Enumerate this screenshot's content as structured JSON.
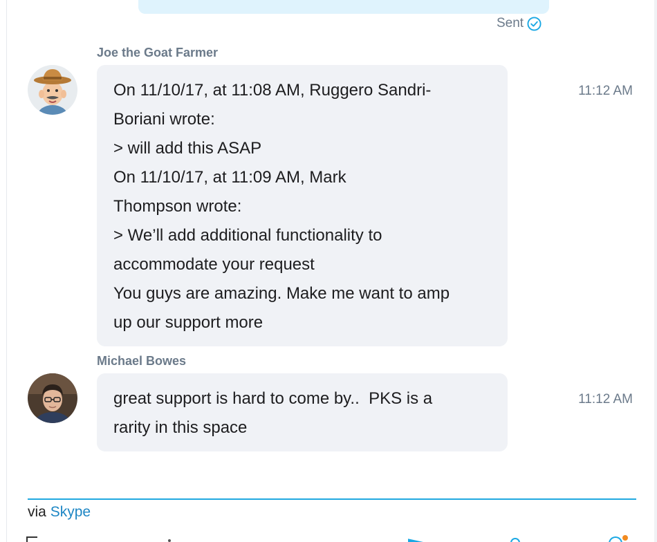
{
  "previous_message": {
    "status": "Sent",
    "status_icon": "check-circle-icon",
    "accent": "#1aa8e4"
  },
  "messages": [
    {
      "sender": "Joe the Goat Farmer",
      "avatar_icon": "farmer-avatar",
      "lines": [
        "On 11/10/17, at 11:08 AM, Ruggero Sandri-",
        "Boriani wrote:",
        "> will add this ASAP",
        "On 11/10/17, at 11:09 AM, Mark",
        "Thompson wrote:",
        "> We’ll add additional functionality to",
        "accommodate your request",
        "You guys are amazing. Make me want to amp",
        "up our support more"
      ],
      "time": "11:12 AM"
    },
    {
      "sender": "Michael Bowes",
      "avatar_icon": "user-photo-avatar",
      "lines": [
        "great support is hard to come by..  PKS is a",
        "rarity in this space"
      ],
      "time": "11:12 AM"
    }
  ],
  "footer": {
    "via_label": "via",
    "link_label": "Skype",
    "line_color": "#20a8e0"
  }
}
